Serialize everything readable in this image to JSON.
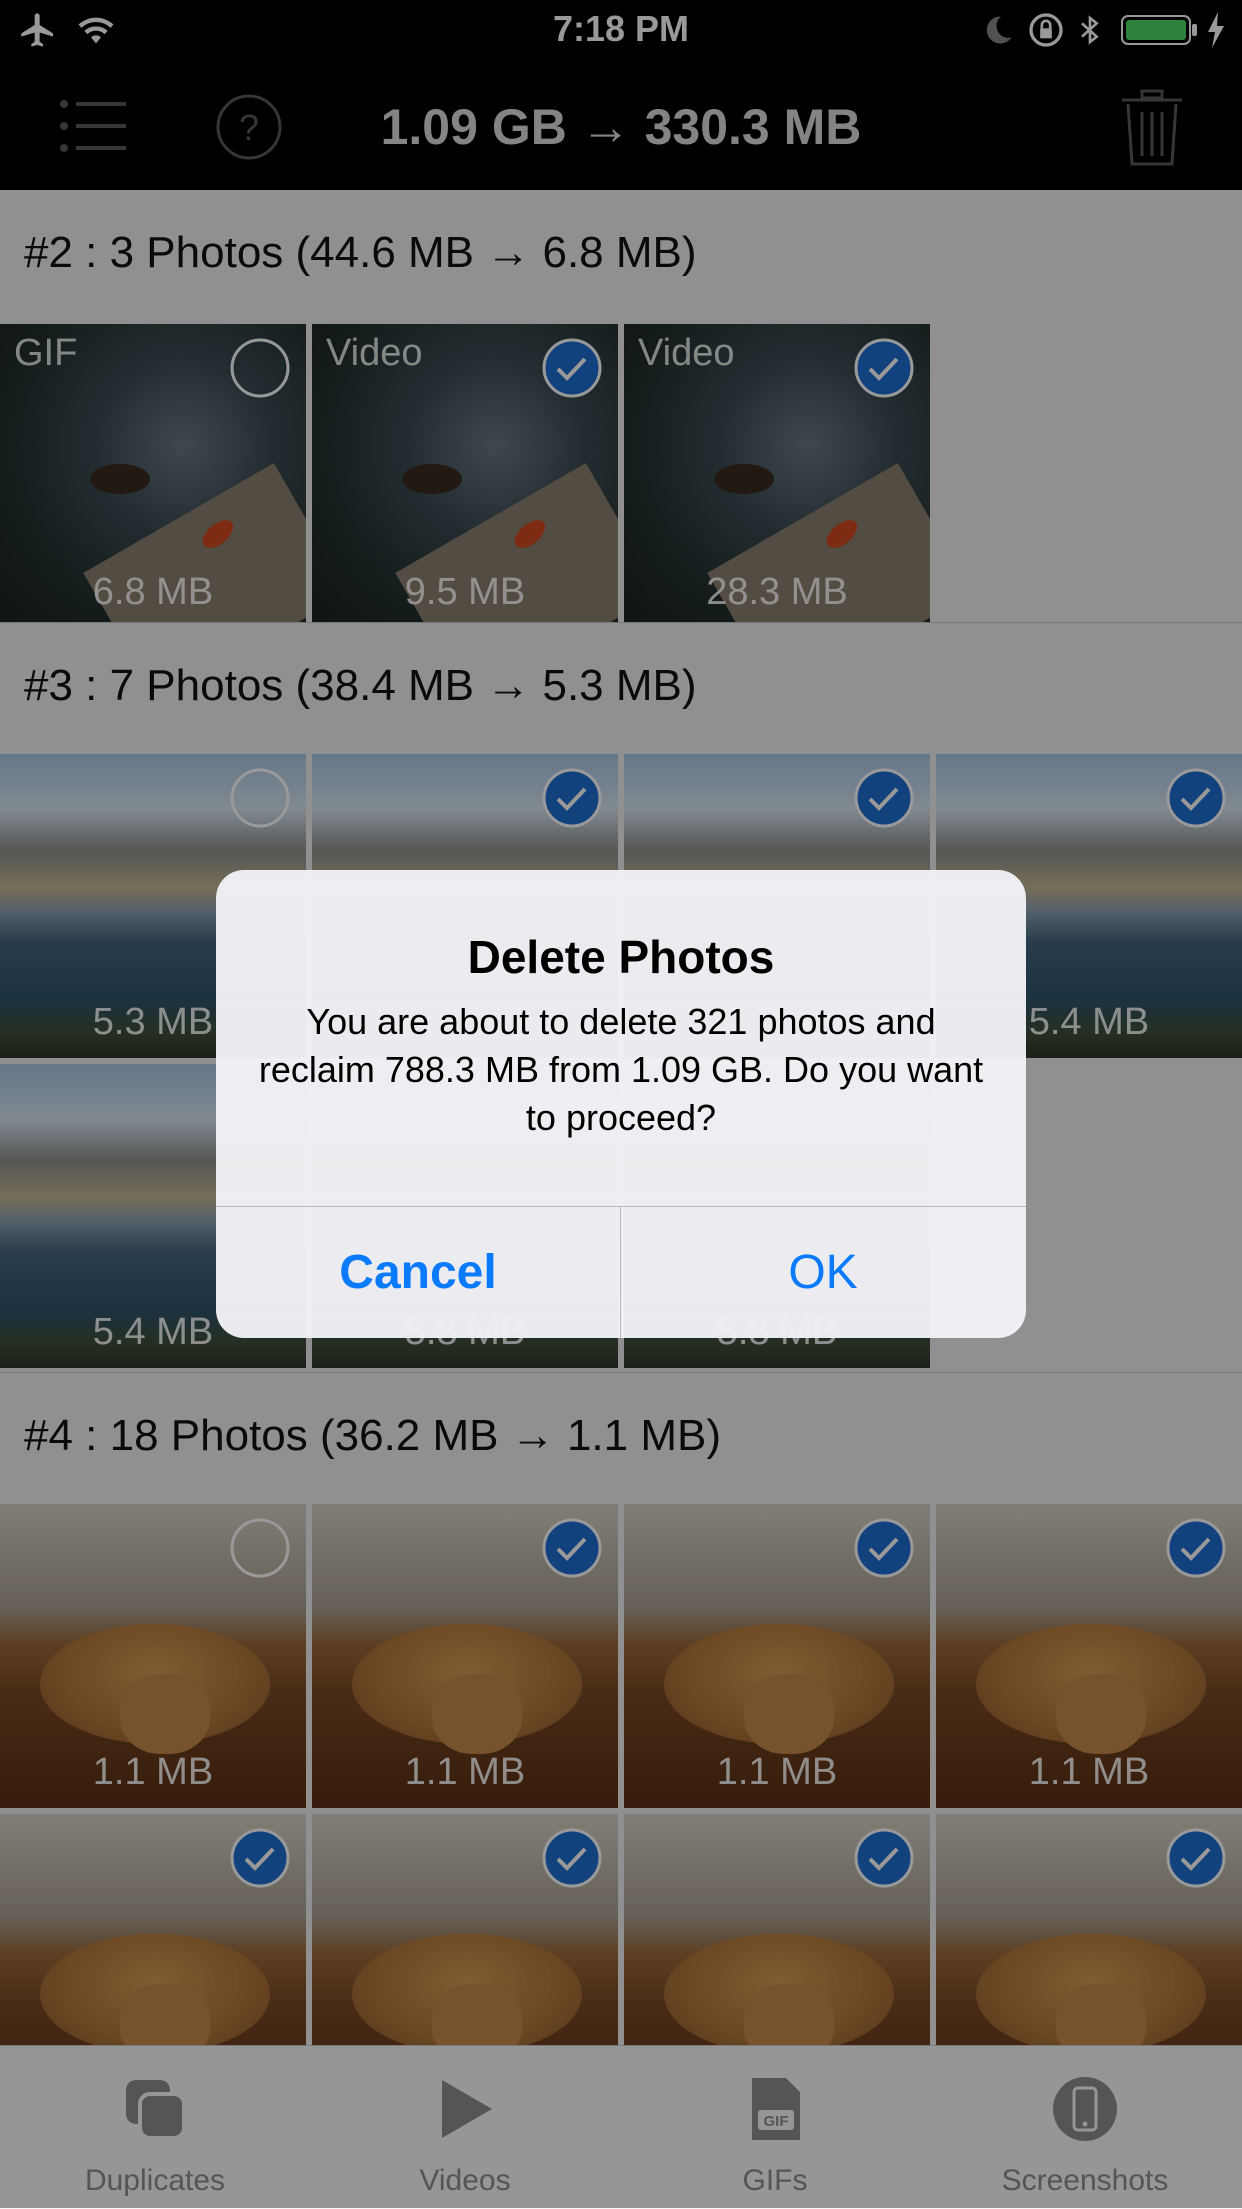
{
  "status_bar": {
    "time": "7:18 PM"
  },
  "header": {
    "title": "1.09 GB → 330.3 MB"
  },
  "groups": [
    {
      "title": "#2 : 3 Photos (44.6 MB → 6.8 MB)",
      "thumbs": [
        {
          "label": "GIF",
          "size": "6.8 MB",
          "checked": false
        },
        {
          "label": "Video",
          "size": "9.5 MB",
          "checked": true
        },
        {
          "label": "Video",
          "size": "28.3 MB",
          "checked": true
        }
      ]
    },
    {
      "title": "#3 : 7 Photos (38.4 MB → 5.3 MB)",
      "thumbs": [
        {
          "size": "5.3 MB",
          "checked": false
        },
        {
          "size": "",
          "checked": true
        },
        {
          "size": "",
          "checked": true
        },
        {
          "size": "5.4 MB",
          "checked": true
        },
        {
          "size": "5.4 MB",
          "checked": false
        },
        {
          "size": "5.8 MB",
          "checked": true
        },
        {
          "size": "5.8 MB",
          "checked": true
        }
      ]
    },
    {
      "title": "#4 : 18 Photos (36.2 MB → 1.1 MB)",
      "thumbs": [
        {
          "size": "1.1 MB",
          "checked": false
        },
        {
          "size": "1.1 MB",
          "checked": true
        },
        {
          "size": "1.1 MB",
          "checked": true
        },
        {
          "size": "1.1 MB",
          "checked": true
        },
        {
          "size": "",
          "checked": true
        },
        {
          "size": "",
          "checked": true
        },
        {
          "size": "",
          "checked": true
        },
        {
          "size": "",
          "checked": true
        }
      ]
    }
  ],
  "tabs": [
    {
      "label": "Duplicates",
      "icon": "duplicates-icon"
    },
    {
      "label": "Videos",
      "icon": "play-icon"
    },
    {
      "label": "GIFs",
      "icon": "gif-icon"
    },
    {
      "label": "Screenshots",
      "icon": "phone-icon"
    }
  ],
  "alert": {
    "title": "Delete Photos",
    "message": "You are about to delete 321 photos and reclaim 788.3 MB from 1.09 GB. Do you want to proceed?",
    "cancel": "Cancel",
    "ok": "OK"
  },
  "colors": {
    "accent": "#0a7aff",
    "check_fill": "#1e6fd0"
  }
}
